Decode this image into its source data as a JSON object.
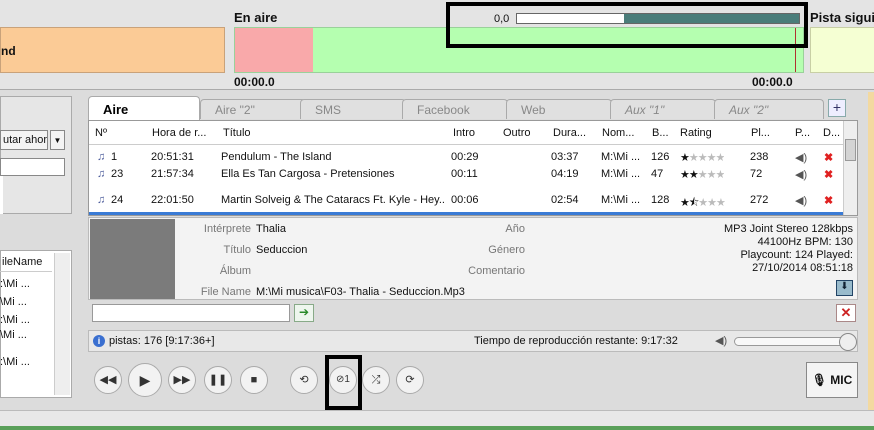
{
  "top": {
    "prev_label": "nd",
    "onair_title": "En aire",
    "onair_time_left": "00:00.0",
    "onair_time_right": "00:00.0",
    "next_title": "Pista siguie",
    "volume_label": "0,0",
    "volume_level": 0.62
  },
  "sidebar": {
    "button_label": "utar ahora",
    "dropdown_arrow": "▼",
    "list_header": "ileName",
    "rows": [
      ":\\Mi ...",
      "\\Mi ...",
      ":\\Mi ...",
      "\\Mi ...",
      ":\\Mi ..."
    ]
  },
  "tabs": [
    {
      "label": "Aire",
      "active": true
    },
    {
      "label": "Aire \"2\""
    },
    {
      "label": "SMS"
    },
    {
      "label": "Facebook"
    },
    {
      "label": "Web"
    },
    {
      "label": "Aux \"1\"",
      "italic": true
    },
    {
      "label": "Aux \"2\"",
      "italic": true
    }
  ],
  "playlist": {
    "columns": [
      "Nº",
      "Hora de r...",
      "Título",
      "Intro",
      "Outro",
      "Dura...",
      "Nom...",
      "B...",
      "Rating",
      "Pl...",
      "P...",
      "D..."
    ],
    "rows": [
      {
        "no": "1",
        "time": "20:51:31",
        "title": "Pendulum - The Island",
        "intro": "00:29",
        "outro": "",
        "dur": "03:37",
        "name": "M:\\Mi ...",
        "bitrate": "126",
        "rating": 1,
        "plays": "238"
      },
      {
        "no": "23",
        "time": "21:57:34",
        "title": "Ella Es Tan Cargosa - Pretensiones",
        "intro": "00:11",
        "outro": "",
        "dur": "04:19",
        "name": "M:\\Mi ...",
        "bitrate": "47",
        "rating": 2,
        "plays": "72"
      },
      {
        "no": "24",
        "time": "22:01:50",
        "title": "Martin Solveig & The Cataracs Ft. Kyle - Hey...",
        "intro": "00:06",
        "outro": "",
        "dur": "02:54",
        "name": "M:\\Mi ...",
        "bitrate": "128",
        "rating": 1.5,
        "plays": "272"
      }
    ]
  },
  "info": {
    "interprete_label": "Intérprete",
    "interprete": "Thalia",
    "titulo_label": "Título",
    "titulo": "Seduccion",
    "album_label": "Álbum",
    "album": "",
    "filename_label": "File Name",
    "filename": "M:\\Mi musica\\F03- Thalia - Seduccion.Mp3",
    "ano_label": "Año",
    "genero_label": "Género",
    "comentario_label": "Comentario",
    "format": "MP3 Joint Stereo 128kbps",
    "rate_bpm": "44100Hz  BPM: 130",
    "playcount": "Playcount: 124  Played:",
    "played_date": "27/10/2014 08:51:18"
  },
  "status": {
    "tracks": "pistas: 176 [9:17:36+]",
    "remaining": "Tiempo de reproducción restante: 9:17:32",
    "volume_level": 1.0
  },
  "transport": {
    "stop_after_count": "1",
    "mic_label": "MIC"
  }
}
